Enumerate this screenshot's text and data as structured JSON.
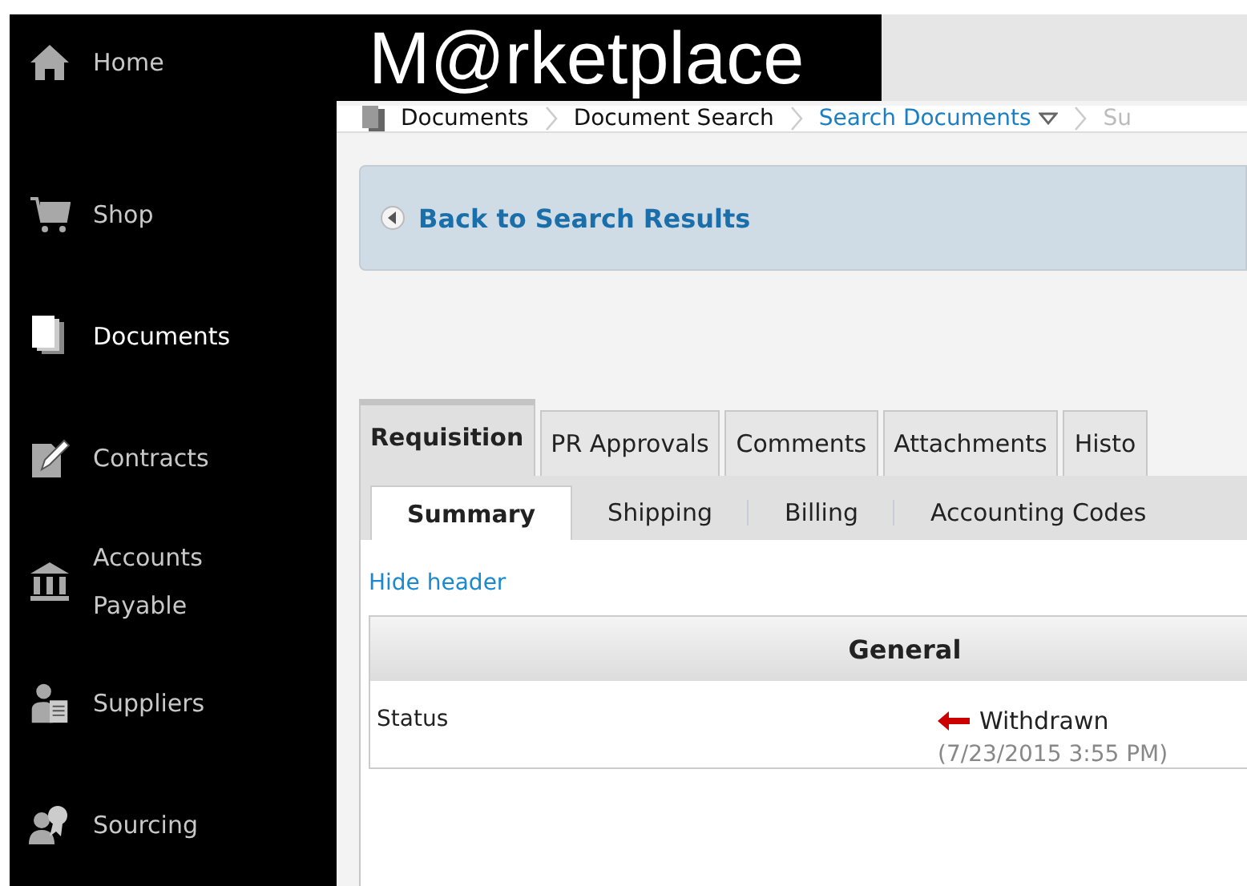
{
  "sidebar": {
    "items": [
      {
        "label": "Home",
        "kind": "home",
        "selected": false
      },
      {
        "label": "Shop",
        "kind": "cart",
        "selected": false
      },
      {
        "label": "Documents",
        "kind": "documents",
        "selected": true
      },
      {
        "label": "Contracts",
        "kind": "contract",
        "selected": false
      },
      {
        "label": "Accounts Payable",
        "kind": "bank",
        "selected": false
      },
      {
        "label": "Suppliers",
        "kind": "supplier",
        "selected": false
      },
      {
        "label": "Sourcing",
        "kind": "sourcing",
        "selected": false
      }
    ]
  },
  "header": {
    "logo": "M@rketplace"
  },
  "breadcrumb": [
    {
      "label": "Documents",
      "kind": "plain"
    },
    {
      "label": "Document Search",
      "kind": "plain"
    },
    {
      "label": "Search Documents",
      "kind": "dropdown"
    },
    {
      "label": "Su",
      "kind": "faded"
    }
  ],
  "back_link": "Back to Search Results",
  "tabs": [
    {
      "label": "Requisition",
      "selected": true
    },
    {
      "label": "PR Approvals",
      "selected": false
    },
    {
      "label": "Comments",
      "selected": false
    },
    {
      "label": "Attachments",
      "selected": false
    },
    {
      "label": "Histo",
      "selected": false
    }
  ],
  "subtabs": [
    {
      "label": "Summary",
      "selected": true
    },
    {
      "label": "Shipping",
      "selected": false
    },
    {
      "label": "Billing",
      "selected": false
    },
    {
      "label": "Accounting Codes",
      "selected": false
    }
  ],
  "hide_header_link": "Hide header",
  "section": {
    "title": "General",
    "rows": [
      {
        "label": "Status",
        "value": "Withdrawn",
        "date": "(7/23/2015 3:55 PM)"
      }
    ]
  }
}
